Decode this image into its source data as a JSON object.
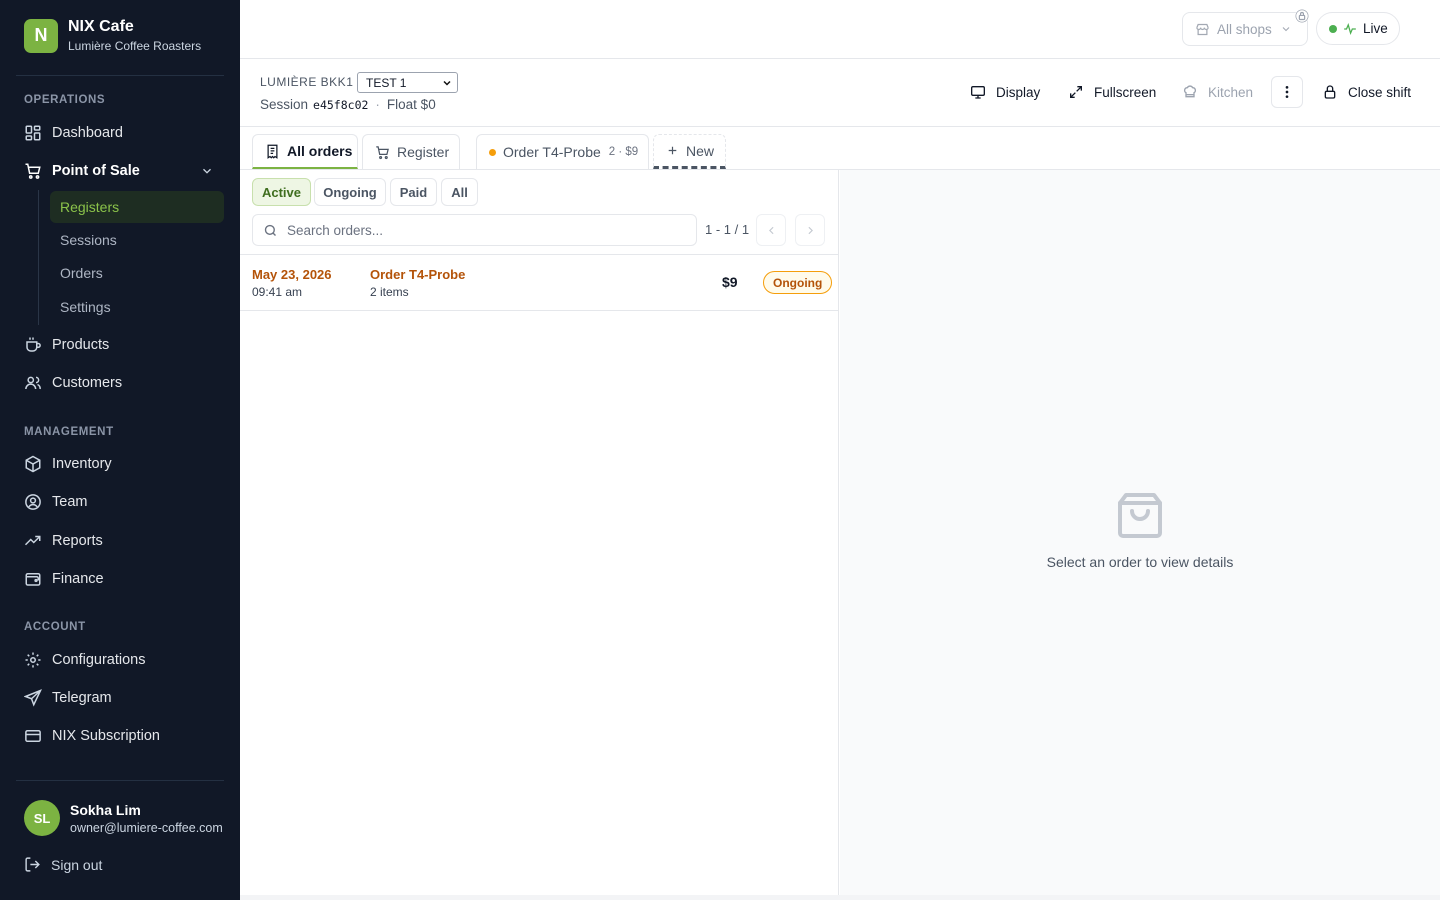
{
  "brand": {
    "logo_letter": "N",
    "name": "NIX Cafe",
    "subtitle": "Lumière Coffee Roasters",
    "accent": "#7cb342"
  },
  "sidebar": {
    "sections": {
      "operations": "OPERATIONS",
      "management": "MANAGEMENT",
      "account": "ACCOUNT"
    },
    "items": {
      "dashboard": "Dashboard",
      "pos": "Point of Sale",
      "products": "Products",
      "customers": "Customers",
      "inventory": "Inventory",
      "team": "Team",
      "reports": "Reports",
      "finance": "Finance",
      "configurations": "Configurations",
      "telegram": "Telegram",
      "subscription": "NIX Subscription"
    },
    "pos_sub": {
      "registers": "Registers",
      "sessions": "Sessions",
      "orders": "Orders",
      "settings": "Settings"
    },
    "user": {
      "initials": "SL",
      "name": "Sokha Lim",
      "email": "owner@lumiere-coffee.com"
    },
    "sign_out": "Sign out"
  },
  "topbar": {
    "shop_selector": "All shops",
    "live": "Live"
  },
  "session": {
    "register_label": "LUMIÈRE BKK1",
    "register_value": "TEST 1",
    "session_label": "Session",
    "session_code": "e45f8c02",
    "separator": "·",
    "float": "Float $0",
    "actions": {
      "display": "Display",
      "fullscreen": "Fullscreen",
      "kitchen": "Kitchen",
      "close_shift": "Close shift"
    }
  },
  "tabs": {
    "all_orders": "All orders",
    "register": "Register",
    "order_tab": "Order T4-Probe",
    "order_tab_meta": "2 · $9",
    "new": "New"
  },
  "filters": {
    "active": "Active",
    "ongoing": "Ongoing",
    "paid": "Paid",
    "all": "All"
  },
  "search": {
    "placeholder": "Search orders..."
  },
  "pagination": {
    "text": "1 - 1 / 1"
  },
  "orders": [
    {
      "date": "May 23, 2026",
      "time": "09:41 am",
      "name": "Order T4-Probe",
      "items": "2 items",
      "total": "$9",
      "status": "Ongoing"
    }
  ],
  "details": {
    "empty_text": "Select an order to view details"
  }
}
